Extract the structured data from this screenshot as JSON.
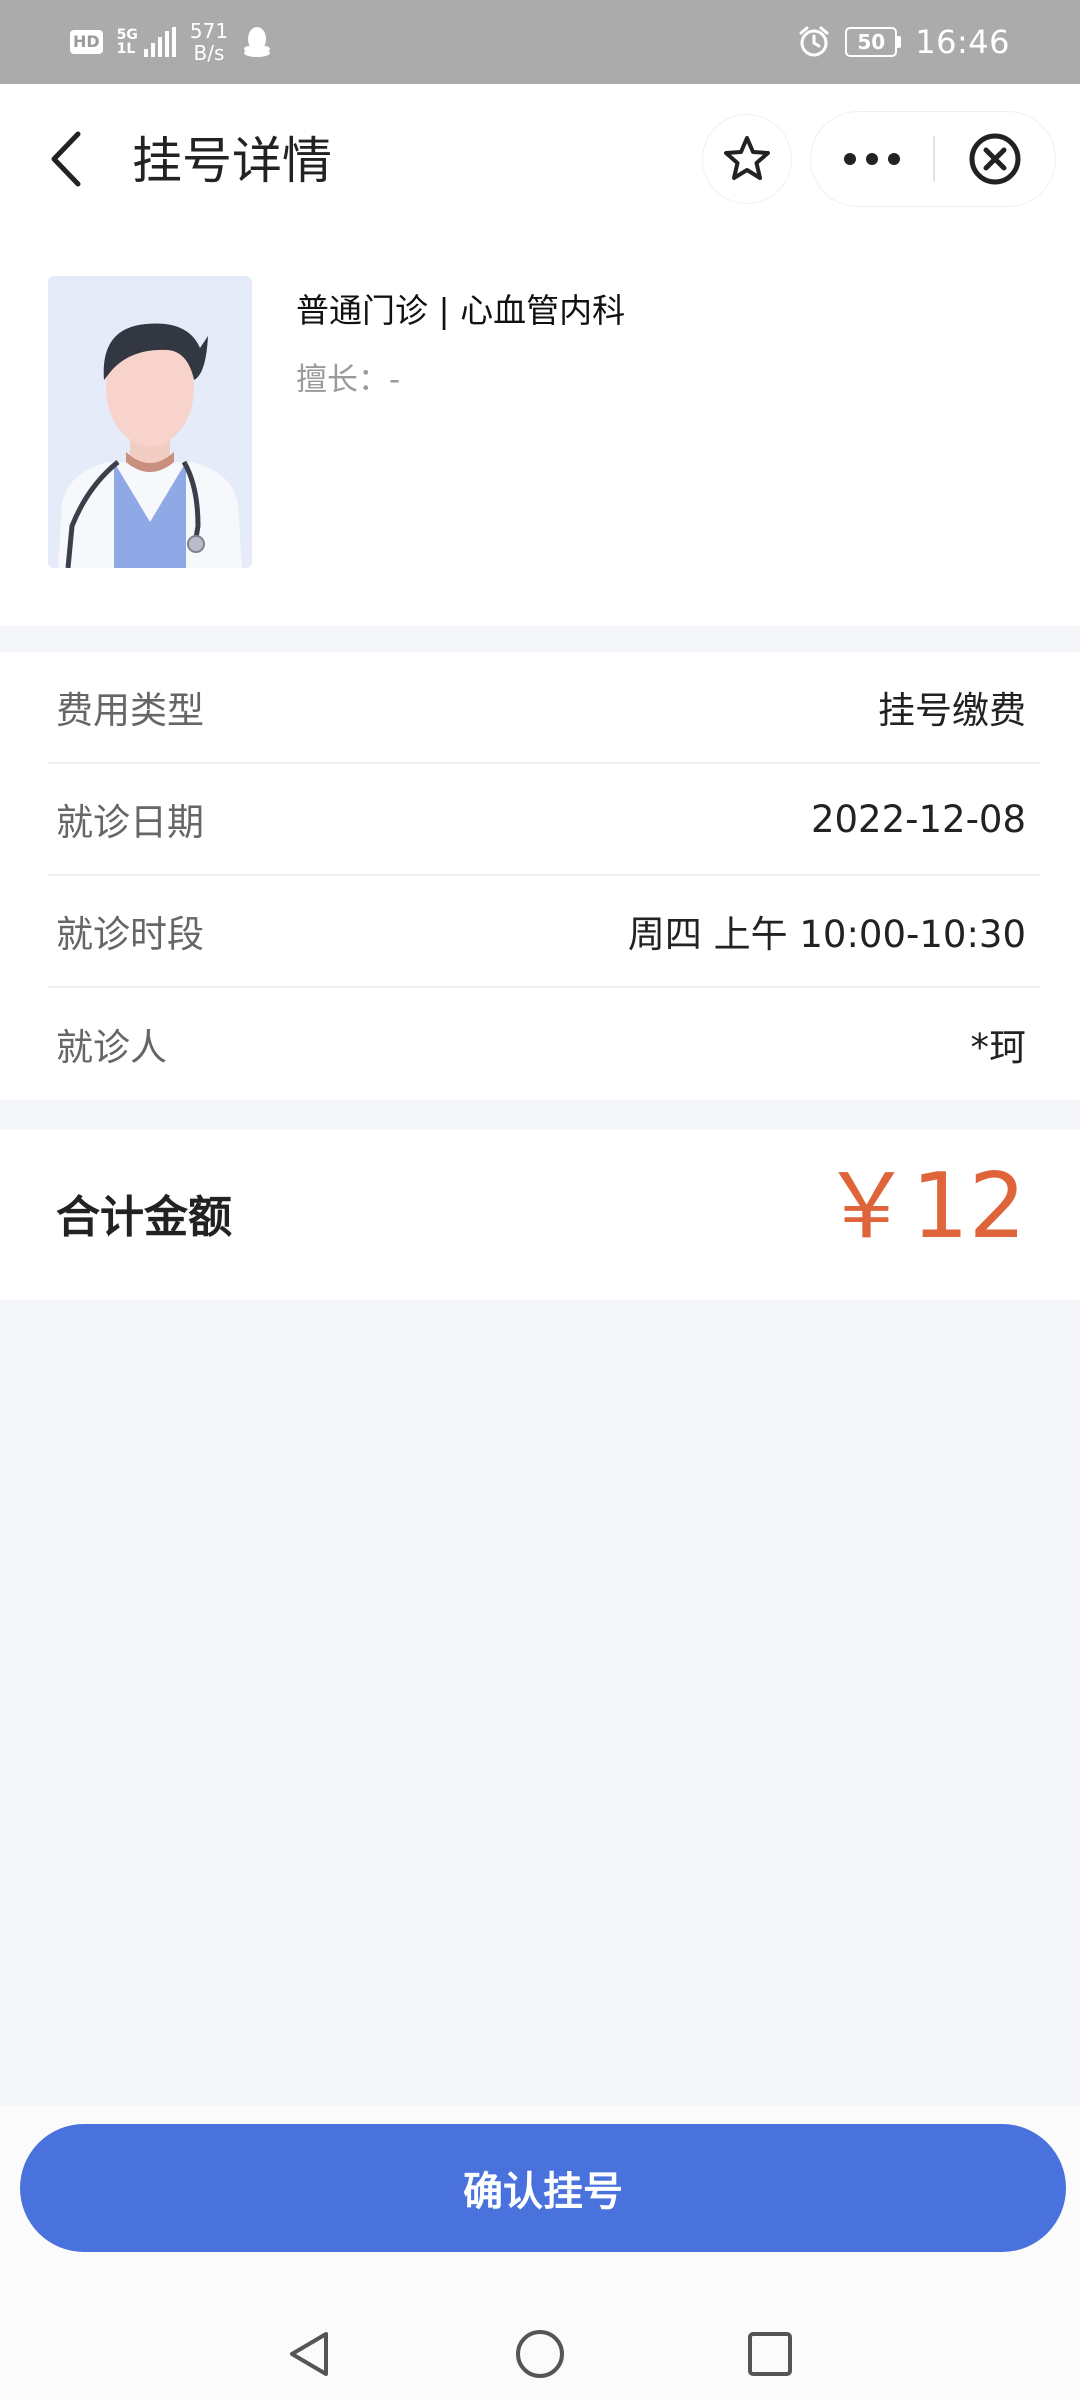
{
  "status_bar": {
    "hd": "HD",
    "network": "5G",
    "network_sub": "1L",
    "speed_value": "571",
    "speed_unit": "B/s",
    "battery": "50",
    "time": "16:46"
  },
  "nav": {
    "title": "挂号详情"
  },
  "doctor": {
    "clinic": "普通门诊 | 心血管内科",
    "specialty": "擅长：-"
  },
  "info": [
    {
      "label": "费用类型",
      "value": "挂号缴费"
    },
    {
      "label": "就诊日期",
      "value": "2022-12-08"
    },
    {
      "label": "就诊时段",
      "value": "周四 上午 10:00-10:30"
    },
    {
      "label": "就诊人",
      "value": "*珂"
    }
  ],
  "total": {
    "label": "合计金额",
    "value": "￥12"
  },
  "actions": {
    "confirm": "确认挂号"
  },
  "colors": {
    "accent": "#4a72dc",
    "price": "#e0643a",
    "status_bar": "#ababab",
    "page_bg": "#f4f6fa"
  }
}
